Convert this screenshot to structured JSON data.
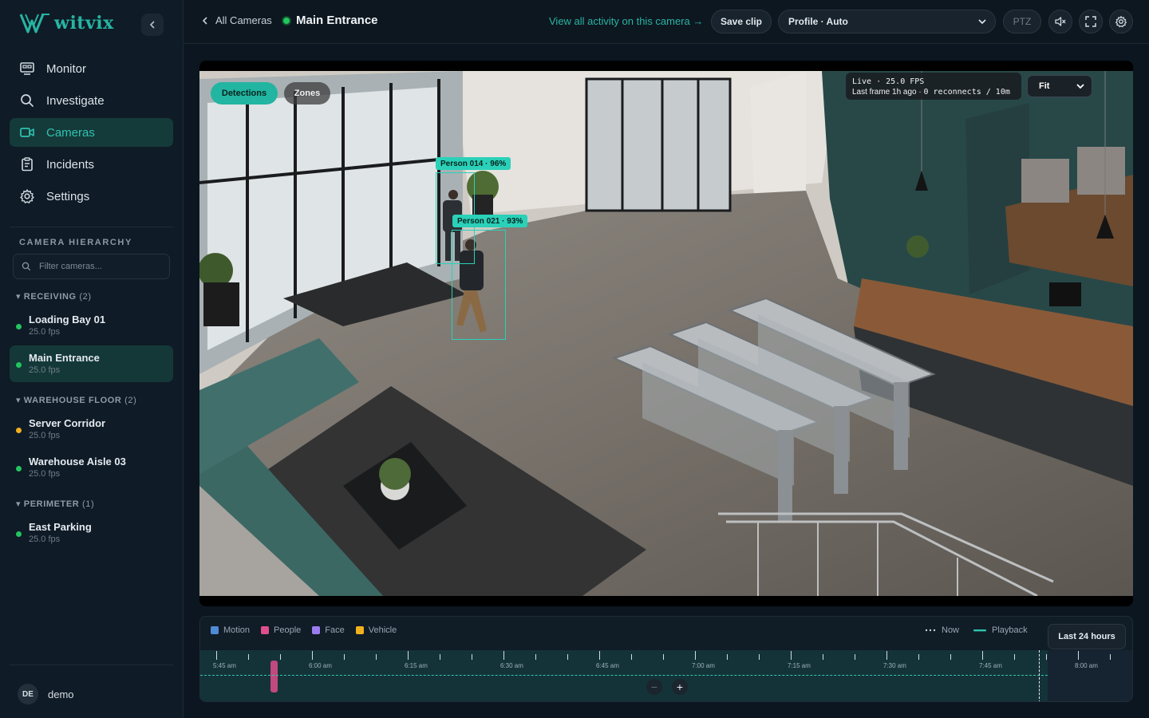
{
  "brand": {
    "name": "witvix",
    "color": "#26b5a3"
  },
  "nav": [
    {
      "label": "Monitor",
      "icon": "monitor-icon",
      "active": false
    },
    {
      "label": "Investigate",
      "icon": "search-icon",
      "active": false
    },
    {
      "label": "Cameras",
      "icon": "camera-icon",
      "active": true
    },
    {
      "label": "Incidents",
      "icon": "clipboard-icon",
      "active": false
    },
    {
      "label": "Settings",
      "icon": "gear-icon",
      "active": false
    }
  ],
  "hierarchy": {
    "title": "CAMERA HIERARCHY",
    "filter_placeholder": "Filter cameras...",
    "groups": [
      {
        "name": "RECEIVING",
        "count": "(2)",
        "cameras": [
          {
            "name": "Loading Bay 01",
            "fps": "25.0 fps",
            "status": "online"
          },
          {
            "name": "Main Entrance",
            "fps": "25.0 fps",
            "status": "online",
            "active": true
          }
        ]
      },
      {
        "name": "WAREHOUSE FLOOR",
        "count": "(2)",
        "cameras": [
          {
            "name": "Server Corridor",
            "fps": "25.0 fps",
            "status": "warning"
          },
          {
            "name": "Warehouse Aisle 03",
            "fps": "25.0 fps",
            "status": "online"
          }
        ]
      },
      {
        "name": "PERIMETER",
        "count": "(1)",
        "cameras": [
          {
            "name": "East Parking",
            "fps": "25.0 fps",
            "status": "online"
          }
        ]
      }
    ]
  },
  "user": {
    "initials": "DE",
    "name": "demo"
  },
  "header": {
    "back_label": "All Cameras",
    "camera_name": "Main Entrance",
    "activity_link": "View all activity on this camera →",
    "save_clip": "Save clip",
    "profile": "Profile · Auto",
    "ptz": "PTZ"
  },
  "video": {
    "detections_label": "Detections",
    "zones_label": "Zones",
    "live_line1": "Live · 25.0 FPS",
    "last_frame": "Last frame 1h ago · ",
    "reconnects": "0 reconnects / 10m",
    "fit": "Fit",
    "detections": [
      {
        "label": "Person 014 · 96%"
      },
      {
        "label": "Person 021 · 93%"
      }
    ]
  },
  "timeline": {
    "legend": [
      {
        "label": "Motion",
        "color": "#4f8ad6"
      },
      {
        "label": "People",
        "color": "#e04f8c"
      },
      {
        "label": "Face",
        "color": "#9a7cf0"
      },
      {
        "label": "Vehicle",
        "color": "#f2b01e"
      }
    ],
    "now_label": "Now",
    "playback_label": "Playback",
    "range": "Last 24 hours",
    "tick_labels": [
      "5:45 am",
      "6:00 am",
      "6:15 am",
      "6:30 am",
      "6:45 am",
      "7:00 am",
      "7:15 am",
      "7:30 am",
      "7:45 am",
      "8:00 am"
    ]
  },
  "status_colors": {
    "online": "#22c55e",
    "warning": "#f2b01e"
  }
}
